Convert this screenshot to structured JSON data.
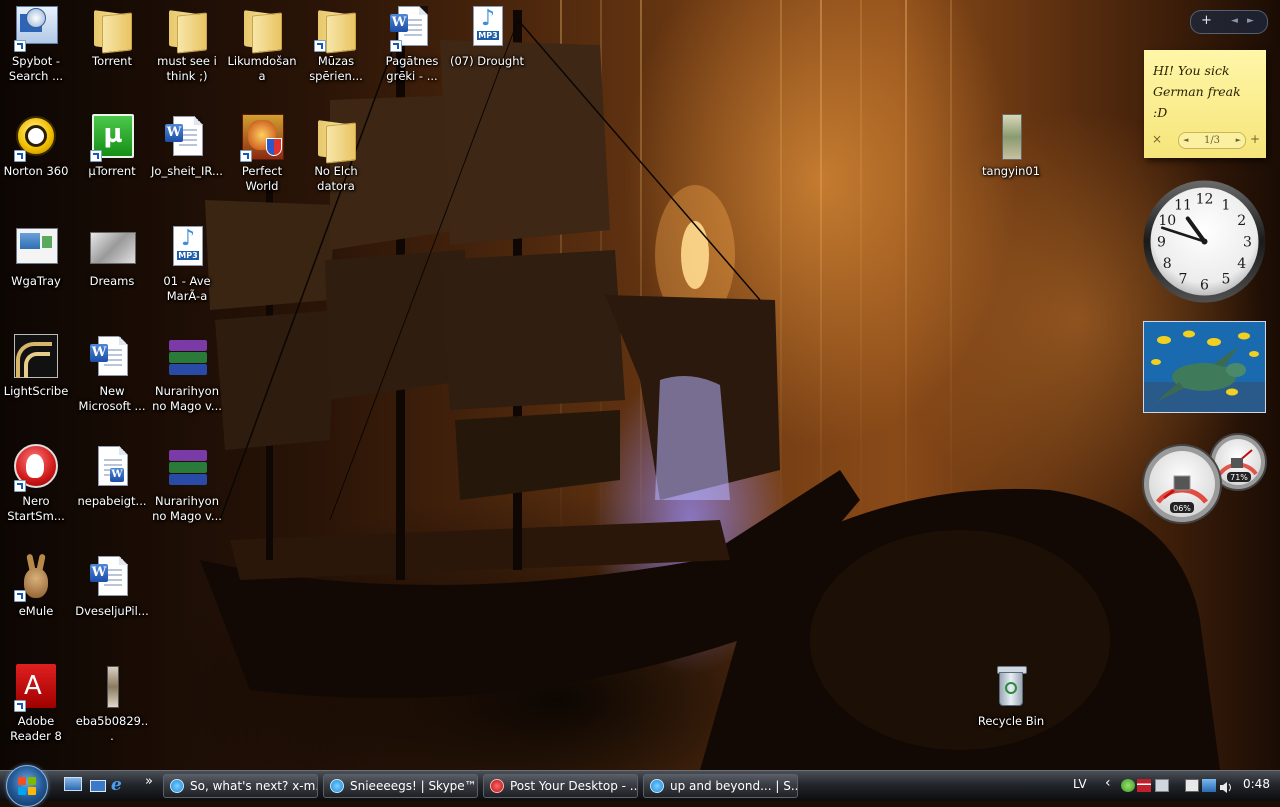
{
  "desktop": {
    "icons": [
      {
        "label": "Spybot - Search ...",
        "icon": "spybot-icon"
      },
      {
        "label": "Torrent",
        "icon": "folder-icon"
      },
      {
        "label": "must see i think ;)",
        "icon": "folder-icon"
      },
      {
        "label": "Likumdošana",
        "icon": "folder-icon"
      },
      {
        "label": "Mūzas spērien...",
        "icon": "folder-icon"
      },
      {
        "label": "Pagātnes grēki - ...",
        "icon": "word-document-icon"
      },
      {
        "label": "(07) Drought",
        "icon": "mp3-file-icon"
      },
      {
        "label": "Norton 360",
        "icon": "norton-icon"
      },
      {
        "label": "µTorrent",
        "icon": "utorrent-icon"
      },
      {
        "label": "Jo_sheit_IR...",
        "icon": "word-document-icon"
      },
      {
        "label": "Perfect World",
        "icon": "perfect-world-icon"
      },
      {
        "label": "No Elch datora",
        "icon": "folder-icon"
      },
      {
        "label": "tangyin01",
        "icon": "image-file-icon"
      },
      {
        "label": "WgaTray",
        "icon": "wgatray-icon"
      },
      {
        "label": "Dreams",
        "icon": "image-file-icon"
      },
      {
        "label": "01 - Ave MarÃ-a",
        "icon": "mp3-file-icon"
      },
      {
        "label": "LightScribe",
        "icon": "lightscribe-icon"
      },
      {
        "label": "New Microsoft ...",
        "icon": "word-document-icon"
      },
      {
        "label": "Nurarihyon no Mago v...",
        "icon": "winrar-archive-icon"
      },
      {
        "label": "Nero StartSm...",
        "icon": "nero-icon"
      },
      {
        "label": "nepabeigt...",
        "icon": "word-document-icon"
      },
      {
        "label": "Nurarihyon no Mago v...",
        "icon": "winrar-archive-icon"
      },
      {
        "label": "eMule",
        "icon": "emule-icon"
      },
      {
        "label": "DveseljuPil...",
        "icon": "word-document-icon"
      },
      {
        "label": "Adobe Reader 8",
        "icon": "adobe-reader-icon"
      },
      {
        "label": "eba5b0829...",
        "icon": "image-file-icon"
      },
      {
        "label": "Recycle Bin",
        "icon": "recycle-bin-icon"
      }
    ]
  },
  "gadgets": {
    "bar": {
      "add": "+",
      "prev": "◄",
      "next": "►"
    },
    "notes": {
      "text": "HI! You sick German freak :D",
      "page": "1/3",
      "close": "×",
      "add": "+"
    },
    "clock": {
      "hour": 10,
      "minute": 48,
      "numbers": [
        "12",
        "1",
        "2",
        "3",
        "4",
        "5",
        "6",
        "7",
        "8",
        "9",
        "10",
        "11"
      ]
    },
    "cpu_meter": {
      "cpu": "06%",
      "memory": "71%"
    }
  },
  "taskbar": {
    "tasks": [
      {
        "label": "So, what's next? x-m...",
        "icon": "skype-icon"
      },
      {
        "label": "Snieeeegs! | Skype™ ...",
        "icon": "skype-icon"
      },
      {
        "label": "Post Your Desktop - ...",
        "icon": "opera-icon"
      },
      {
        "label": "up and beyond... | S...",
        "icon": "skype-icon"
      }
    ],
    "overflow": "»",
    "tray": {
      "language": "LV",
      "chevron": "‹",
      "time": "0:48"
    }
  }
}
